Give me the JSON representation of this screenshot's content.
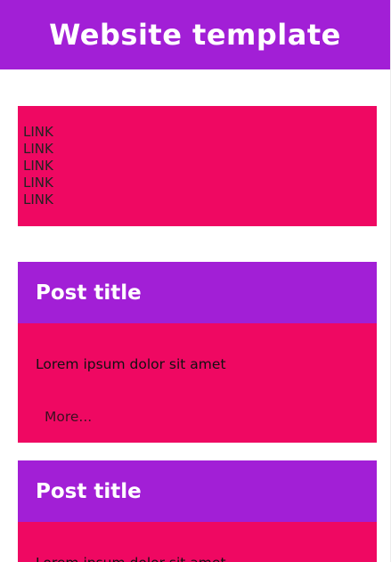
{
  "header": {
    "title": "Website template"
  },
  "nav": {
    "links": [
      "LINK",
      "LINK",
      "LINK",
      "LINK",
      "LINK"
    ]
  },
  "posts": [
    {
      "title": "Post title",
      "body": "Lorem ipsum dolor sit amet",
      "more_label": "More..."
    },
    {
      "title": "Post title",
      "body": "Lorem ipsum dolor sit amet"
    }
  ],
  "colors": {
    "header_bg": "#a21fd6",
    "accent_bg": "#ef0862",
    "page_bg": "#ffffff"
  }
}
